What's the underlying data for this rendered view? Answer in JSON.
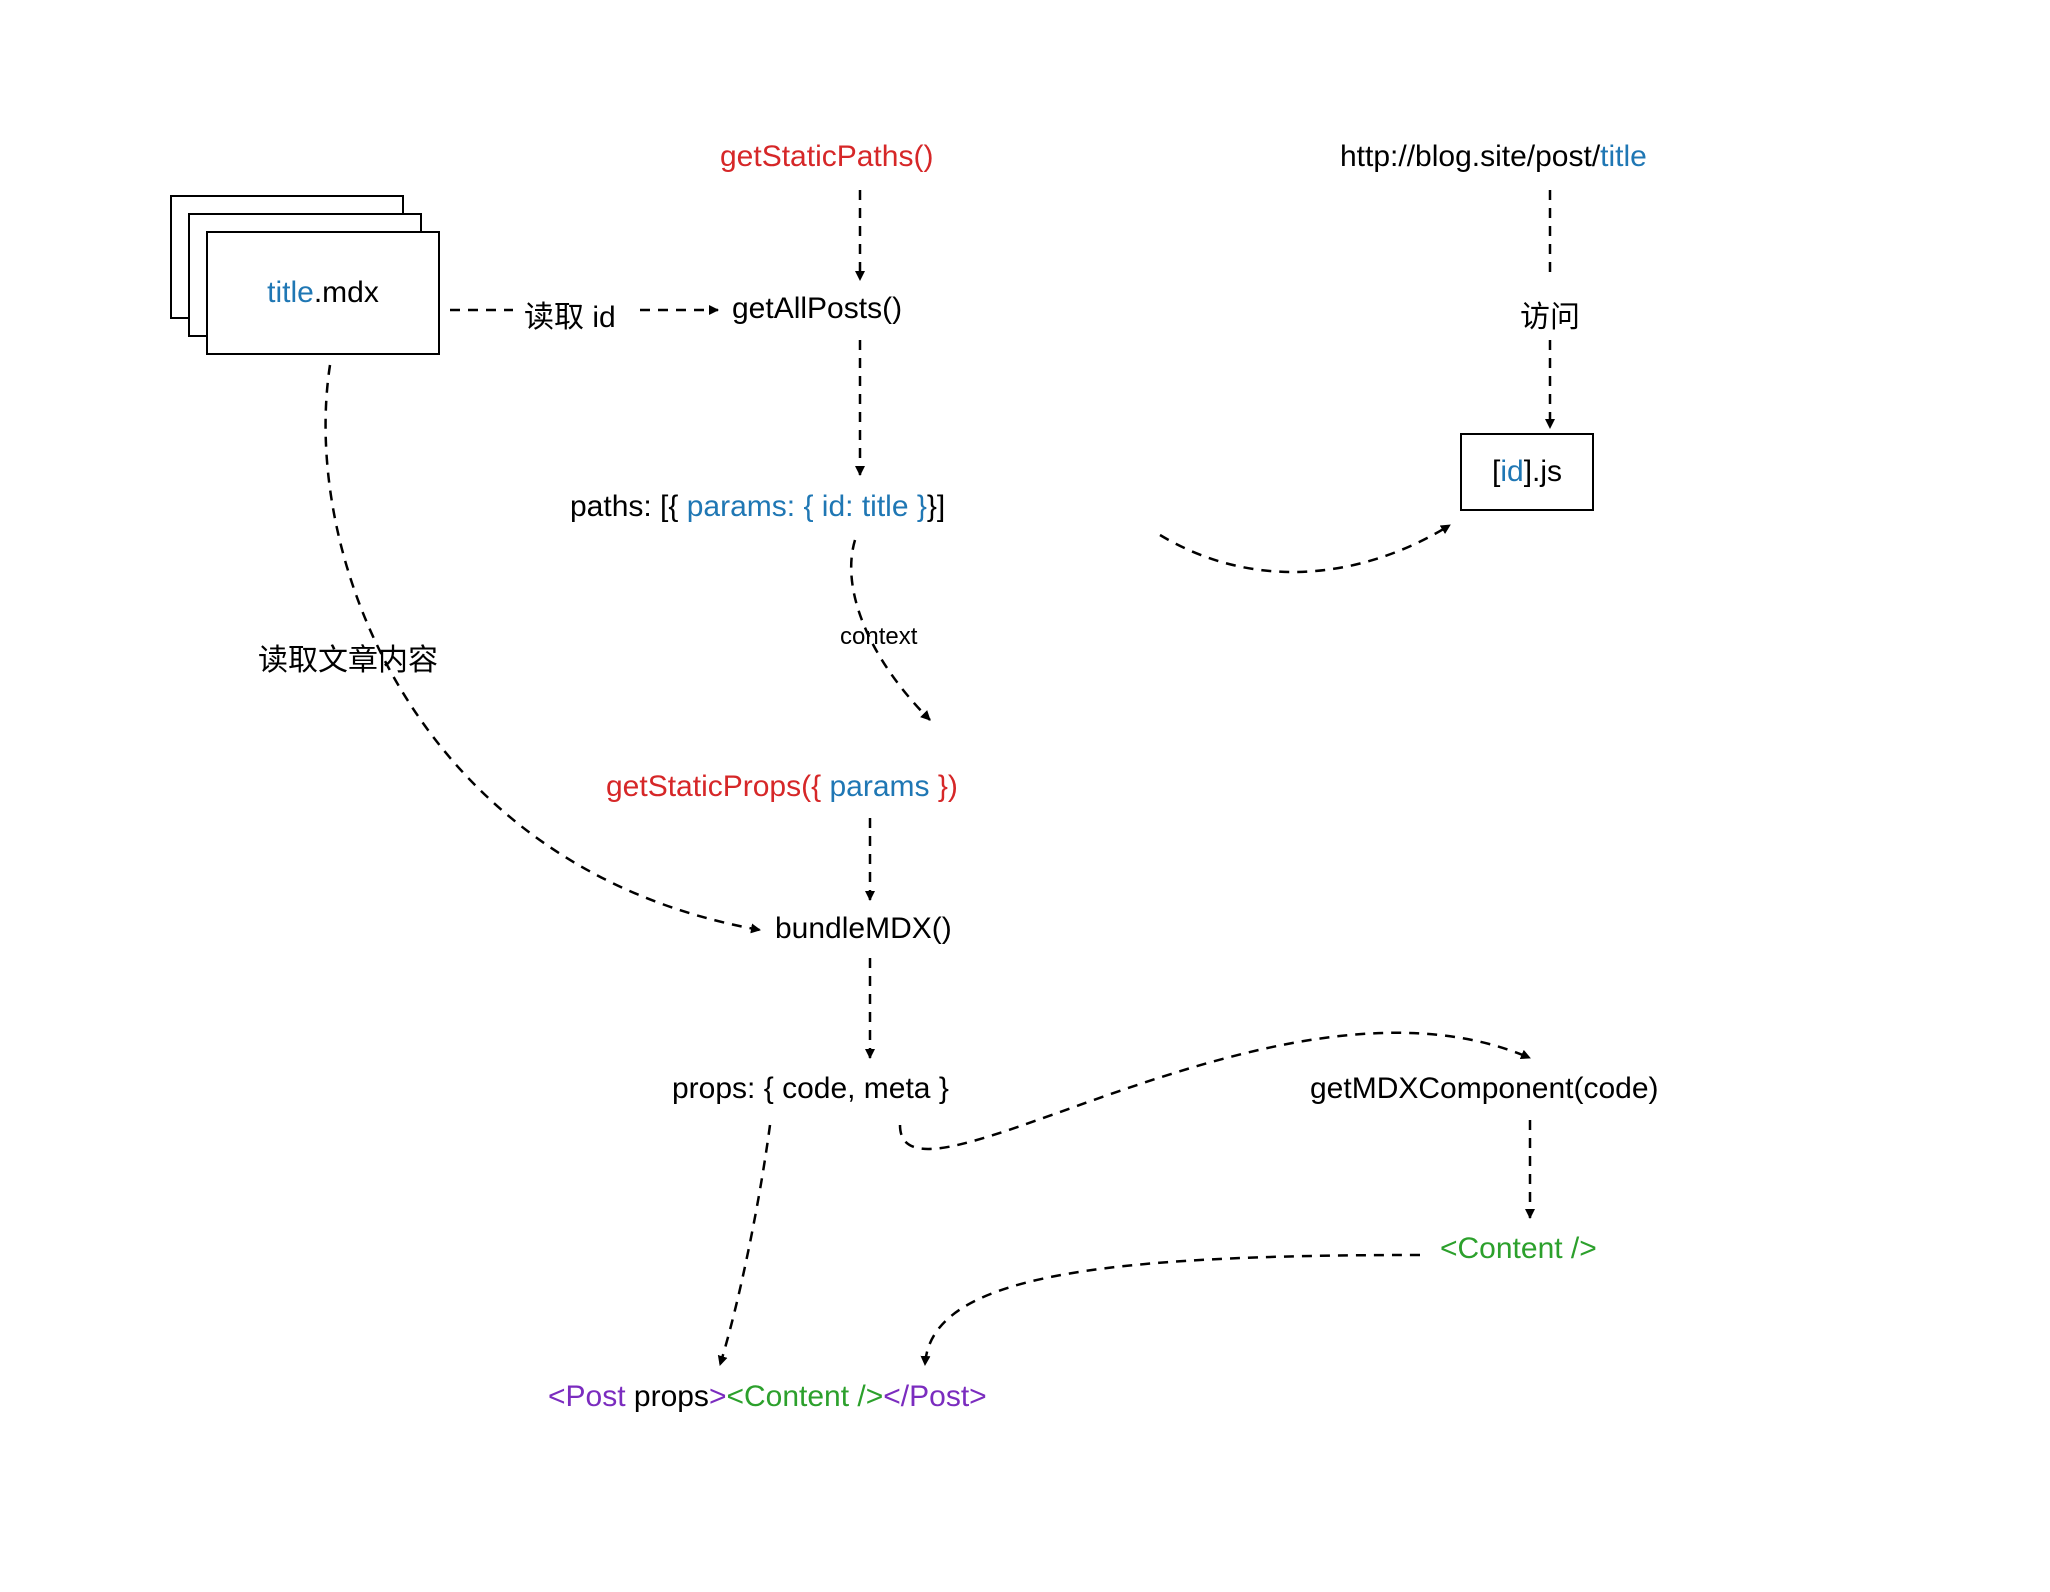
{
  "file": {
    "title": "title",
    "ext": ".mdx"
  },
  "getStaticPaths": "getStaticPaths()",
  "readId": "读取 id",
  "getAllPosts": "getAllPosts()",
  "paths": {
    "prefix": "paths: [{ ",
    "params": "params: { id: title }",
    "suffix": "}]"
  },
  "context": "context",
  "readContent": "读取文章内容",
  "getStaticProps": {
    "fn": "getStaticProps({ ",
    "arg": "params",
    "close": " })"
  },
  "bundleMDX": "bundleMDX()",
  "props": "props: { code, meta }",
  "getMDXComponent": "getMDXComponent(code)",
  "contentJSX": "<Content />",
  "render": {
    "open": "<Post ",
    "props": "props",
    "openClose": ">",
    "child": "<Content />",
    "close": "</Post>"
  },
  "url": {
    "prefix": "http://blog.site/post/",
    "title": "title"
  },
  "visit": "访问",
  "idjs": {
    "open": "[",
    "id": "id",
    "close": "].js"
  }
}
